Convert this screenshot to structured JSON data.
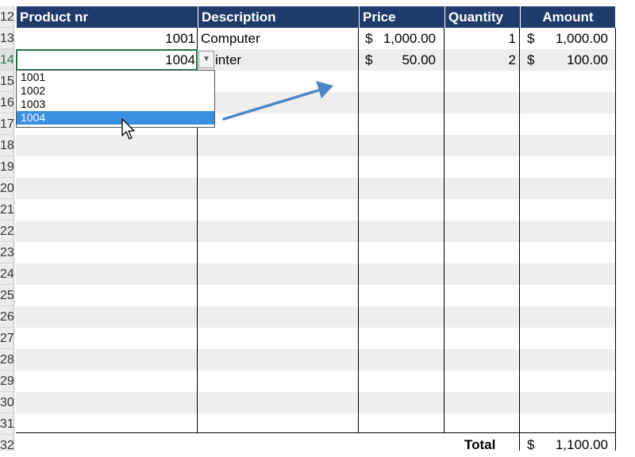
{
  "header": {
    "product_nr": "Product nr",
    "description": "Description",
    "price": "Price",
    "quantity": "Quantity",
    "amount": "Amount"
  },
  "row_numbers": [
    "12",
    "13",
    "14",
    "15",
    "16",
    "17",
    "18",
    "19",
    "20",
    "21",
    "22",
    "23",
    "24",
    "25",
    "26",
    "27",
    "28",
    "29",
    "30",
    "31",
    "32"
  ],
  "rows": [
    {
      "product_nr": "1001",
      "description": "Computer",
      "price_currency": "$",
      "price": "1,000.00",
      "quantity": "1",
      "amount_currency": "$",
      "amount": "1,000.00"
    },
    {
      "product_nr": "1004",
      "description": "inter",
      "price_currency": "$",
      "price": "50.00",
      "quantity": "2",
      "amount_currency": "$",
      "amount": "100.00"
    }
  ],
  "dropdown": {
    "options": [
      "1001",
      "1002",
      "1003",
      "1004"
    ],
    "selected": "1004"
  },
  "total": {
    "label": "Total",
    "currency": "$",
    "value": "1,100.00"
  },
  "colors": {
    "header_bg": "#1f3b6b",
    "band": "#eeeeee",
    "selection": "#3b8fdf",
    "active_border": "#217346",
    "arrow": "#4f86c6"
  }
}
